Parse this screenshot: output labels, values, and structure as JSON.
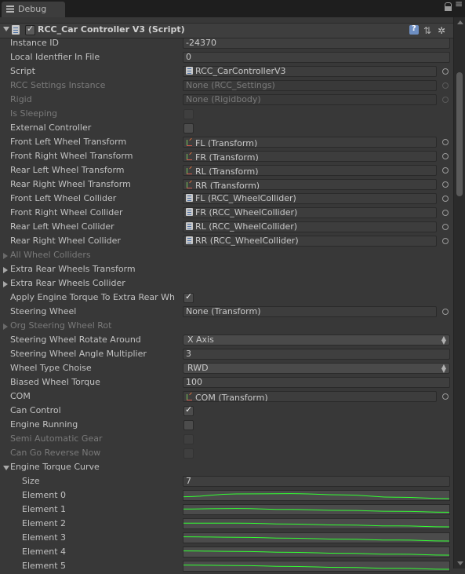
{
  "tab": {
    "label": "Debug"
  },
  "component": {
    "title": "RCC_Car Controller V3 (Script)"
  },
  "rows": [
    {
      "label": "Instance ID",
      "type": "text",
      "value": "-24370"
    },
    {
      "label": "Local Identfier In File",
      "type": "text",
      "value": "0"
    },
    {
      "label": "Script",
      "type": "object",
      "icon": "script-icon",
      "value": "RCC_CarControllerV3"
    },
    {
      "label": "RCC Settings Instance",
      "type": "object",
      "value": "None (RCC_Settings)",
      "dim": true
    },
    {
      "label": "Rigid",
      "type": "object",
      "value": "None (Rigidbody)",
      "dim": true
    },
    {
      "label": "Is Sleeping",
      "type": "check",
      "checked": false,
      "dim": true
    },
    {
      "label": "External Controller",
      "type": "check",
      "checked": false
    },
    {
      "label": "Front Left Wheel Transform",
      "type": "object",
      "icon": "transform-icon",
      "value": "FL (Transform)"
    },
    {
      "label": "Front Right Wheel Transform",
      "type": "object",
      "icon": "transform-icon",
      "value": "FR (Transform)"
    },
    {
      "label": "Rear Left Wheel Transform",
      "type": "object",
      "icon": "transform-icon",
      "value": "RL (Transform)"
    },
    {
      "label": "Rear Right Wheel Transform",
      "type": "object",
      "icon": "transform-icon",
      "value": "RR (Transform)"
    },
    {
      "label": "Front Left Wheel Collider",
      "type": "object",
      "icon": "script-icon",
      "value": "FL (RCC_WheelCollider)"
    },
    {
      "label": "Front Right Wheel Collider",
      "type": "object",
      "icon": "script-icon",
      "value": "FR (RCC_WheelCollider)"
    },
    {
      "label": "Rear Left Wheel Collider",
      "type": "object",
      "icon": "script-icon",
      "value": "RL (RCC_WheelCollider)"
    },
    {
      "label": "Rear Right Wheel Collider",
      "type": "object",
      "icon": "script-icon",
      "value": "RR (RCC_WheelCollider)"
    },
    {
      "label": "All Wheel Colliders",
      "type": "foldout",
      "open": false,
      "dim": true
    },
    {
      "label": "Extra Rear Wheels Transform",
      "type": "foldout",
      "open": false
    },
    {
      "label": "Extra Rear Wheels Collider",
      "type": "foldout",
      "open": false
    },
    {
      "label": "Apply Engine Torque To Extra Rear Wh",
      "type": "check",
      "checked": true
    },
    {
      "label": "Steering Wheel",
      "type": "object",
      "value": "None (Transform)"
    },
    {
      "label": "Org Steering Wheel Rot",
      "type": "foldout",
      "open": false,
      "dim": true
    },
    {
      "label": "Steering Wheel Rotate Around",
      "type": "dropdown",
      "value": "X Axis"
    },
    {
      "label": "Steering Wheel Angle Multiplier",
      "type": "text",
      "value": "3"
    },
    {
      "label": "Wheel Type Choise",
      "type": "dropdown",
      "value": "RWD"
    },
    {
      "label": "Biased Wheel Torque",
      "type": "text",
      "value": "100"
    },
    {
      "label": "COM",
      "type": "object",
      "icon": "transform-icon",
      "value": "COM (Transform)"
    },
    {
      "label": "Can Control",
      "type": "check",
      "checked": true
    },
    {
      "label": "Engine Running",
      "type": "check",
      "checked": false
    },
    {
      "label": "Semi Automatic Gear",
      "type": "check",
      "checked": false,
      "dim": true
    },
    {
      "label": "Can Go Reverse Now",
      "type": "check",
      "checked": false,
      "dim": true
    },
    {
      "label": "Engine Torque Curve",
      "type": "foldout",
      "open": true
    },
    {
      "label": "Size",
      "type": "text",
      "value": "7",
      "indent": true
    },
    {
      "label": "Element 0",
      "type": "curve",
      "indent": true,
      "curve": [
        0.55,
        0.25,
        0.22,
        0.35,
        0.6,
        0.75
      ]
    },
    {
      "label": "Element 1",
      "type": "curve",
      "indent": true,
      "curve": [
        0.35,
        0.3,
        0.4,
        0.5,
        0.6,
        0.7
      ]
    },
    {
      "label": "Element 2",
      "type": "curve",
      "indent": true,
      "curve": [
        0.35,
        0.35,
        0.45,
        0.55,
        0.65,
        0.75
      ]
    },
    {
      "label": "Element 3",
      "type": "curve",
      "indent": true,
      "curve": [
        0.3,
        0.35,
        0.45,
        0.55,
        0.65,
        0.75
      ]
    },
    {
      "label": "Element 4",
      "type": "curve",
      "indent": true,
      "curve": [
        0.3,
        0.35,
        0.45,
        0.55,
        0.65,
        0.75
      ]
    },
    {
      "label": "Element 5",
      "type": "curve",
      "indent": true,
      "curve": [
        0.3,
        0.35,
        0.45,
        0.55,
        0.65,
        0.75
      ]
    }
  ],
  "colors": {
    "curve_line": "#33ff33",
    "background": "#383838"
  }
}
